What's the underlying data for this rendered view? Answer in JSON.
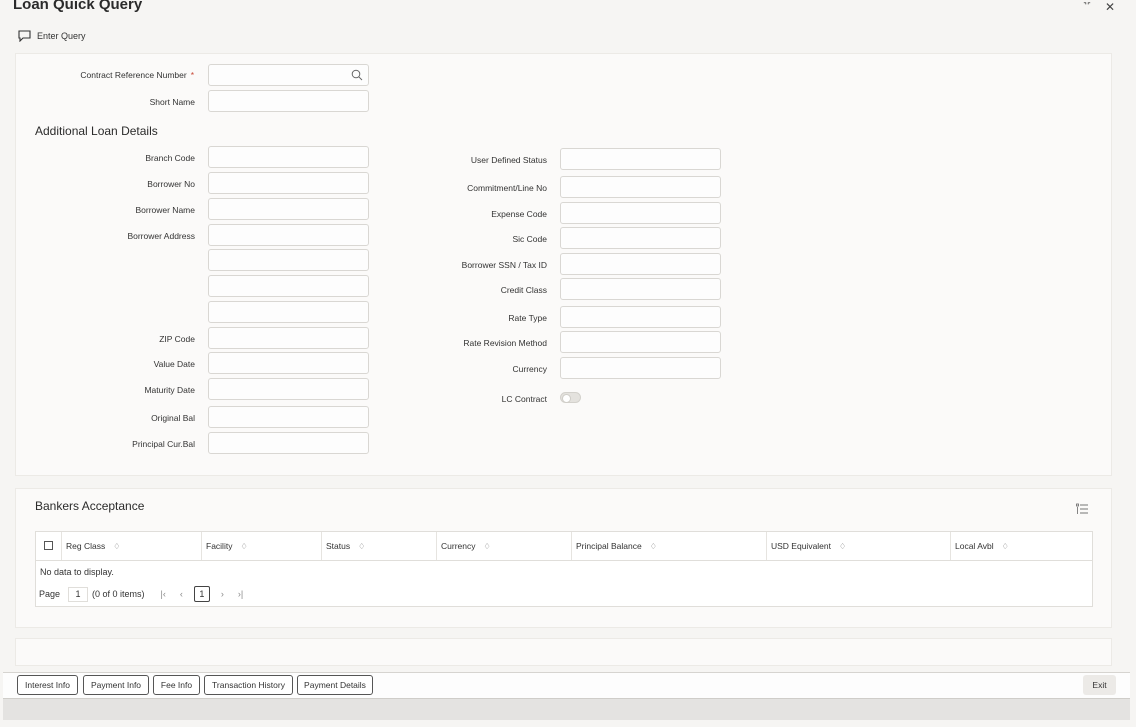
{
  "window": {
    "title": "Loan Quick Query",
    "min_label": "˺˹",
    "close_label": "✕"
  },
  "toolbar": {
    "enter_query": "Enter Query"
  },
  "header_fields": {
    "contract_ref": {
      "label": "Contract Reference Number",
      "required": "*",
      "value": ""
    },
    "short_name": {
      "label": "Short Name",
      "value": ""
    }
  },
  "additional": {
    "title": "Additional Loan Details",
    "left": [
      {
        "label": "Branch Code"
      },
      {
        "label": "Borrower No"
      },
      {
        "label": "Borrower Name"
      },
      {
        "label": "Borrower Address"
      },
      {
        "label": "ZIP Code"
      },
      {
        "label": "Value Date"
      },
      {
        "label": "Maturity Date"
      },
      {
        "label": "Original Bal"
      },
      {
        "label": "Principal Cur.Bal"
      }
    ],
    "right": [
      {
        "label": "User Defined Status"
      },
      {
        "label": "Commitment/Line No"
      },
      {
        "label": "Expense Code"
      },
      {
        "label": "Sic Code"
      },
      {
        "label": "Borrower SSN / Tax ID"
      },
      {
        "label": "Credit Class"
      },
      {
        "label": "Rate Type"
      },
      {
        "label": "Rate Revision Method"
      },
      {
        "label": "Currency"
      },
      {
        "label": "LC Contract"
      }
    ]
  },
  "bankers": {
    "title": "Bankers Acceptance",
    "columns": [
      "Reg Class",
      "Facility",
      "Status",
      "Currency",
      "Principal Balance",
      "USD Equivalent",
      "Local Avbl"
    ],
    "sort_glyph": "♢",
    "empty_text": "No data to display.",
    "pager": {
      "page_label": "Page",
      "page_value": "1",
      "items_text": "(0 of 0 items)",
      "current": "1",
      "first": "|‹",
      "prev": "‹",
      "next": "›",
      "last": "›|"
    }
  },
  "footer_buttons": {
    "interest_info": "Interest Info",
    "payment_info": "Payment Info",
    "fee_info": "Fee Info",
    "transaction_history": "Transaction History",
    "payment_details": "Payment Details",
    "exit": "Exit"
  }
}
